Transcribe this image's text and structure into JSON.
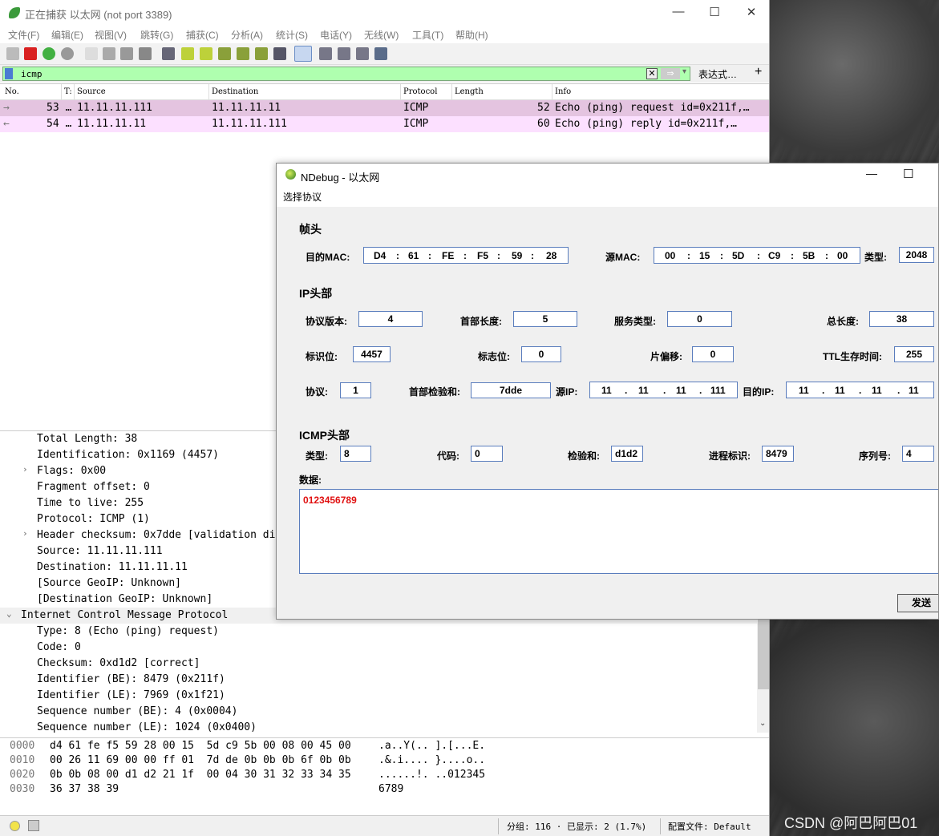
{
  "wireshark": {
    "title": "正在捕获 以太网 (not port 3389)",
    "window_controls": {
      "min": "—",
      "max": "☐",
      "close": "✕"
    },
    "menu": [
      "文件(F)",
      "编辑(E)",
      "视图(V)",
      "跳转(G)",
      "捕获(C)",
      "分析(A)",
      "统计(S)",
      "电话(Y)",
      "无线(W)",
      "工具(T)",
      "帮助(H)"
    ],
    "filter": {
      "value": "icmp",
      "expression_button": "表达式…",
      "add": "+",
      "clear": "✕",
      "apply": "⇒",
      "dropdown": "▾"
    },
    "columns": [
      "No.",
      "T:",
      "Source",
      "Destination",
      "Protocol",
      "Length",
      "Info"
    ],
    "packets": [
      {
        "dir": "→",
        "no": "53 …",
        "src": "11.11.11.111",
        "dst": "11.11.11.11",
        "proto": "ICMP",
        "len": "52",
        "info": "Echo (ping) request  id=0x211f,…"
      },
      {
        "dir": "←",
        "no": "54 …",
        "src": "11.11.11.11",
        "dst": "11.11.11.111",
        "proto": "ICMP",
        "len": "60",
        "info": "Echo (ping) reply    id=0x211f,…"
      }
    ],
    "details": [
      {
        "indent": 1,
        "expander": "",
        "text": "Total Length: 38"
      },
      {
        "indent": 1,
        "expander": "",
        "text": "Identification: 0x1169 (4457)"
      },
      {
        "indent": 1,
        "expander": "›",
        "text": "Flags: 0x00"
      },
      {
        "indent": 1,
        "expander": "",
        "text": "Fragment offset: 0"
      },
      {
        "indent": 1,
        "expander": "",
        "text": "Time to live: 255"
      },
      {
        "indent": 1,
        "expander": "",
        "text": "Protocol: ICMP (1)"
      },
      {
        "indent": 1,
        "expander": "›",
        "text": "Header checksum: 0x7dde [validation di"
      },
      {
        "indent": 1,
        "expander": "",
        "text": "Source: 11.11.11.111"
      },
      {
        "indent": 1,
        "expander": "",
        "text": "Destination: 11.11.11.11"
      },
      {
        "indent": 1,
        "expander": "",
        "text": "[Source GeoIP: Unknown]"
      },
      {
        "indent": 1,
        "expander": "",
        "text": "[Destination GeoIP: Unknown]"
      },
      {
        "indent": 0,
        "expander": "⌄",
        "text": "Internet Control Message Protocol"
      },
      {
        "indent": 1,
        "expander": "",
        "text": "Type: 8 (Echo (ping) request)"
      },
      {
        "indent": 1,
        "expander": "",
        "text": "Code: 0"
      },
      {
        "indent": 1,
        "expander": "",
        "text": "Checksum: 0xd1d2 [correct]"
      },
      {
        "indent": 1,
        "expander": "",
        "text": "Identifier (BE): 8479 (0x211f)"
      },
      {
        "indent": 1,
        "expander": "",
        "text": "Identifier (LE): 7969 (0x1f21)"
      },
      {
        "indent": 1,
        "expander": "",
        "text": "Sequence number (BE): 4 (0x0004)"
      },
      {
        "indent": 1,
        "expander": "",
        "text": "Sequence number (LE): 1024 (0x0400)"
      }
    ],
    "hex": [
      {
        "off": "0000",
        "bytes": "d4 61 fe f5 59 28 00 15  5d c9 5b 00 08 00 45 00",
        "ascii": ".a..Y(.. ].[...E."
      },
      {
        "off": "0010",
        "bytes": "00 26 11 69 00 00 ff 01  7d de 0b 0b 0b 6f 0b 0b",
        "ascii": ".&.i.... }....o.."
      },
      {
        "off": "0020",
        "bytes": "0b 0b 08 00 d1 d2 21 1f  00 04 30 31 32 33 34 35",
        "ascii": "......!. ..012345"
      },
      {
        "off": "0030",
        "bytes": "36 37 38 39",
        "ascii": "6789"
      }
    ],
    "status": {
      "packets": "分组: 116 · 已显示: 2 (1.7%)",
      "profile": "配置文件: Default"
    }
  },
  "ndebug": {
    "title": "NDebug - 以太网",
    "window_controls": {
      "min": "—",
      "max": "☐"
    },
    "menu": "选择协议",
    "frame": {
      "heading": "帧头",
      "dst_label": "目的MAC:",
      "dst": [
        "D4",
        "61",
        "FE",
        "F5",
        "59",
        "28"
      ],
      "src_label": "源MAC:",
      "src": [
        "00",
        "15",
        "5D",
        "C9",
        "5B",
        "00"
      ],
      "type_label": "类型:",
      "type": "2048"
    },
    "ip": {
      "heading": "IP头部",
      "version_label": "协议版本:",
      "version": "4",
      "ihl_label": "首部长度:",
      "ihl": "5",
      "tos_label": "服务类型:",
      "tos": "0",
      "total_label": "总长度:",
      "total": "38",
      "id_label": "标识位:",
      "id": "4457",
      "flags_label": "标志位:",
      "flags": "0",
      "frag_label": "片偏移:",
      "frag": "0",
      "ttl_label": "TTL生存时间:",
      "ttl": "255",
      "proto_label": "协议:",
      "proto": "1",
      "csum_label": "首部检验和:",
      "csum": "7dde",
      "src_label": "源IP:",
      "src": [
        "11",
        "11",
        "11",
        "111"
      ],
      "dst_label": "目的IP:",
      "dst": [
        "11",
        "11",
        "11",
        "11"
      ]
    },
    "icmp": {
      "heading": "ICMP头部",
      "type_label": "类型:",
      "type": "8",
      "code_label": "代码:",
      "code": "0",
      "csum_label": "检验和:",
      "csum": "d1d2",
      "pid_label": "进程标识:",
      "pid": "8479",
      "seq_label": "序列号:",
      "seq": "4"
    },
    "data_label": "数据:",
    "data": "0123456789",
    "send": "发送"
  },
  "watermark": "CSDN @阿巴阿巴01"
}
